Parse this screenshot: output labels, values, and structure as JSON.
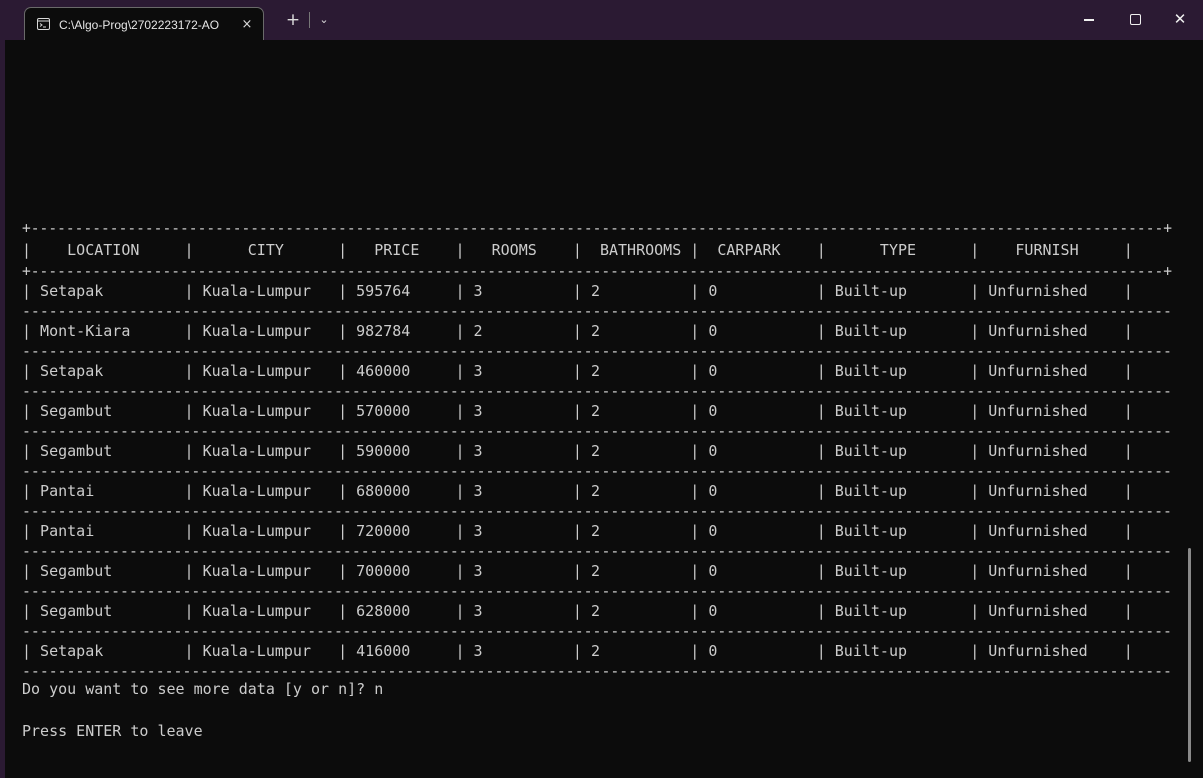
{
  "window": {
    "tab_title": "C:\\Algo-Prog\\2702223172-AO",
    "tab_close_glyph": "×",
    "new_tab_glyph": "+",
    "dropdown_glyph": "⌄",
    "minimize_glyph": "–",
    "close_glyph": "✕"
  },
  "table": {
    "border_line": "+---------------------------------------------------------------------------------------------------------------------------------+",
    "header_line": "|    LOCATION     |      CITY      |   PRICE    |   ROOMS    |  BATHROOMS |  CARPARK    |      TYPE      |    FURNISH     |",
    "row_separator": "---------------------------------------------------------------------------------------------------------------------------------",
    "rows": [
      "| Setapak         | Kuala-Lumpur   | 595764     | 3          | 2          | 0           | Built-up       | Unfurnished    |",
      "| Mont-Kiara      | Kuala-Lumpur   | 982784     | 2          | 2          | 0           | Built-up       | Unfurnished    |",
      "| Setapak         | Kuala-Lumpur   | 460000     | 3          | 2          | 0           | Built-up       | Unfurnished    |",
      "| Segambut        | Kuala-Lumpur   | 570000     | 3          | 2          | 0           | Built-up       | Unfurnished    |",
      "| Segambut        | Kuala-Lumpur   | 590000     | 3          | 2          | 0           | Built-up       | Unfurnished    |",
      "| Pantai          | Kuala-Lumpur   | 680000     | 3          | 2          | 0           | Built-up       | Unfurnished    |",
      "| Pantai          | Kuala-Lumpur   | 720000     | 3          | 2          | 0           | Built-up       | Unfurnished    |",
      "| Segambut        | Kuala-Lumpur   | 700000     | 3          | 2          | 0           | Built-up       | Unfurnished    |",
      "| Segambut        | Kuala-Lumpur   | 628000     | 3          | 2          | 0           | Built-up       | Unfurnished    |",
      "| Setapak         | Kuala-Lumpur   | 416000     | 3          | 2          | 0           | Built-up       | Unfurnished    |"
    ]
  },
  "prompt": {
    "question": "Do you want to see more data [y or n]? n",
    "leave": "Press ENTER to leave"
  }
}
